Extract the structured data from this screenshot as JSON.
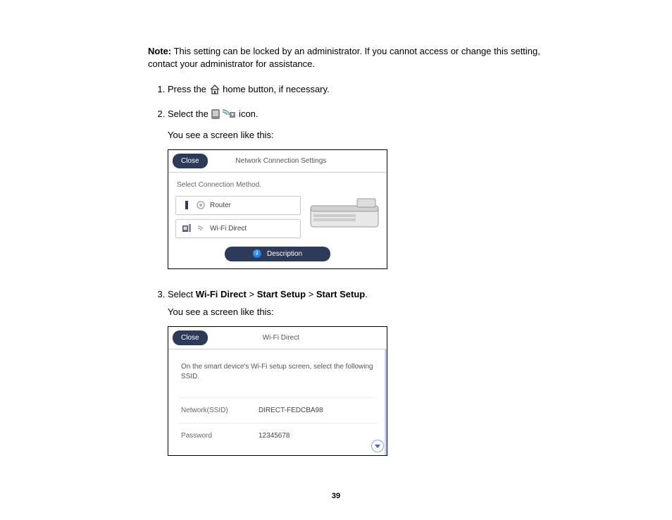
{
  "note": {
    "label": "Note:",
    "text": " This setting can be locked by an administrator. If you cannot access or change this setting, contact your administrator for assistance."
  },
  "steps": {
    "s1_a": "Press the ",
    "s1_b": " home button, if necessary.",
    "s2_a": "Select the ",
    "s2_b": " icon.",
    "s2_sub": "You see a screen like this:",
    "s3_a": "Select ",
    "s3_b1": "Wi-Fi Direct",
    "s3_sep": " > ",
    "s3_b2": "Start Setup",
    "s3_b3": "Start Setup",
    "s3_end": ".",
    "s3_sub": "You see a screen like this:"
  },
  "screen1": {
    "close": "Close",
    "title": "Network Connection Settings",
    "subtitle": "Select Connection Method.",
    "opt_router": "Router",
    "opt_wifidirect": "Wi-Fi Direct",
    "description": "Description"
  },
  "screen2": {
    "close": "Close",
    "title": "Wi-Fi Direct",
    "instruction": "On the smart device's Wi-Fi setup screen, select the following SSID.",
    "ssid_label": "Network(SSID)",
    "ssid_value": "DIRECT-FEDCBA98",
    "pwd_label": "Password",
    "pwd_value": "12345678"
  },
  "page_number": "39"
}
